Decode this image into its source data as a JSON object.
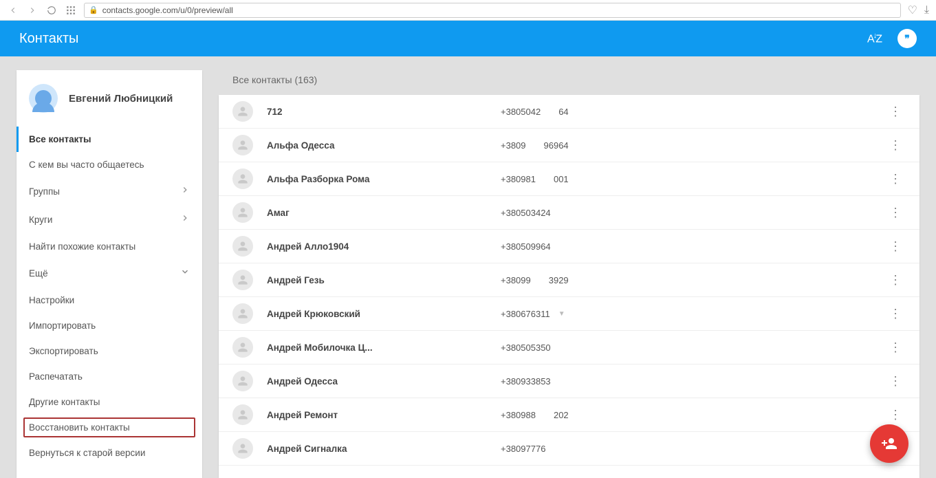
{
  "browser": {
    "url": "contacts.google.com/u/0/preview/all"
  },
  "header": {
    "title": "Контакты",
    "sort_label": "AZ"
  },
  "profile": {
    "name": "Евгений Любницкий"
  },
  "sidebar": {
    "items": [
      {
        "label": "Все контакты",
        "active": true
      },
      {
        "label": "С кем вы часто общаетесь"
      },
      {
        "label": "Группы",
        "expand": "right"
      },
      {
        "label": "Круги",
        "expand": "right"
      },
      {
        "label": "Найти похожие контакты"
      },
      {
        "label": "Ещё",
        "expand": "down"
      },
      {
        "label": "Настройки"
      },
      {
        "label": "Импортировать"
      },
      {
        "label": "Экспортировать"
      },
      {
        "label": "Распечатать"
      },
      {
        "label": "Другие контакты"
      },
      {
        "label": "Восстановить контакты",
        "highlight": true
      },
      {
        "label": "Вернуться к старой версии"
      }
    ]
  },
  "main": {
    "title": "Все контакты (163)",
    "contacts": [
      {
        "name": "712",
        "phone": "+3805042  64"
      },
      {
        "name": "Альфа Одесса",
        "phone": "+3809  96964"
      },
      {
        "name": "Альфа Разборка Рома",
        "phone": "+380981  001"
      },
      {
        "name": "Амаг",
        "phone": "+380503424"
      },
      {
        "name": "Андрей Алло1904",
        "phone": "+380509964"
      },
      {
        "name": "Андрей Гезь",
        "phone": "+38099  3929"
      },
      {
        "name": "Андрей Крюковский",
        "phone": "+380676311",
        "dropdown": true
      },
      {
        "name": "Андрей Мобилочка Ц...",
        "phone": "+380505350"
      },
      {
        "name": "Андрей Одесса",
        "phone": "+380933853"
      },
      {
        "name": "Андрей Ремонт",
        "phone": "+380988  202"
      },
      {
        "name": "Андрей Сигналка",
        "phone": "+38097776"
      }
    ]
  }
}
